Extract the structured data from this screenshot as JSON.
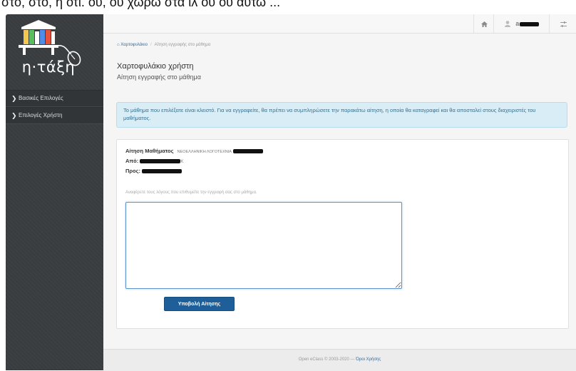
{
  "top_strip": {
    "text": "στο, στο, ή ότι. ου, ου χωρώ στα ιλ ου ου αυτώ ..."
  },
  "brand": {
    "name": "η·τάξη"
  },
  "sidebar": {
    "items": [
      {
        "label": "Βασικές Επιλογές"
      },
      {
        "label": "Επιλογές Χρήστη"
      }
    ]
  },
  "header": {
    "home_icon": "home-icon",
    "user_icon": "user-icon",
    "username_initial": "a",
    "settings_icon": "settings-icon"
  },
  "breadcrumb": {
    "home": "Χαρτοφυλάκιο",
    "current": "Αίτηση εγγραφής στο μάθημα"
  },
  "page": {
    "title": "Χαρτοφυλάκιο χρήστη",
    "subtitle": "Αίτηση εγγραφής στο μάθημα"
  },
  "alert": {
    "text": "Το μάθημα που επιλέξατε είναι κλειστό. Για να εγγραφείτε, θα πρέπει να συμπληρώσετε την παρακάτω αίτηση, η οποία θα καταγραφεί και θα αποσταλεί στους διαχειριστές του μαθήματος."
  },
  "request": {
    "course_label": "Αίτηση Μαθήματος",
    "course_name": "ΝΕΟΕΛΛΗΝΙΚΗ ΛΟΓΟΤΕΧΝΙΑ",
    "from_label": "Από:",
    "to_label": "Προς:",
    "from_suffix": "K",
    "reason_label": "Αναφέρετε τους λόγους που επιθυμείτε την εγγραφή σας στο μάθημα.",
    "textarea_value": "",
    "submit_label": "Υποβολή Αίτησης"
  },
  "footer": {
    "copyright": "Open eClass © 2003-2020 —",
    "terms": "Όροι Χρήσης"
  },
  "colors": {
    "sidebar_bg": "#3a3d40",
    "alert_bg": "#d9edf7",
    "alert_text": "#31708f",
    "button_bg": "#1e5f99",
    "link": "#3b6a95"
  }
}
